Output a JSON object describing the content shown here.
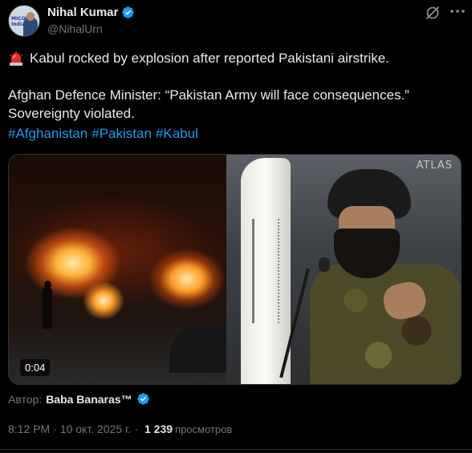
{
  "author": {
    "name": "Nihal Kumar",
    "handle": "@NihalUrn",
    "avatar_text": "MICON India"
  },
  "post": {
    "line1": "Kabul rocked by explosion after reported Pakistani airstrike.",
    "line2": "Afghan Defence Minister: “Pakistan Army will face consequences.”",
    "line3": "Sovereignty violated.",
    "hashtags": [
      "#Afghanistan",
      "#Pakistan",
      "#Kabul"
    ]
  },
  "media": {
    "video_duration": "0:04",
    "watermark": "ATLAS"
  },
  "attribution": {
    "label": "Автор:",
    "name": "Baba Banaras™"
  },
  "meta": {
    "time": "8:12 PM",
    "separator": "·",
    "date": "10 окт. 2025 г.",
    "views_count": "1 239",
    "views_label": "просмотров"
  },
  "colors": {
    "background": "#000000",
    "text": "#e7e9ea",
    "secondary": "#71767b",
    "link": "#1d9bf0",
    "verified": "#1d9bf0"
  },
  "icons": [
    "verified-badge-icon",
    "grok-icon",
    "more-icon",
    "siren-emoji-icon"
  ]
}
